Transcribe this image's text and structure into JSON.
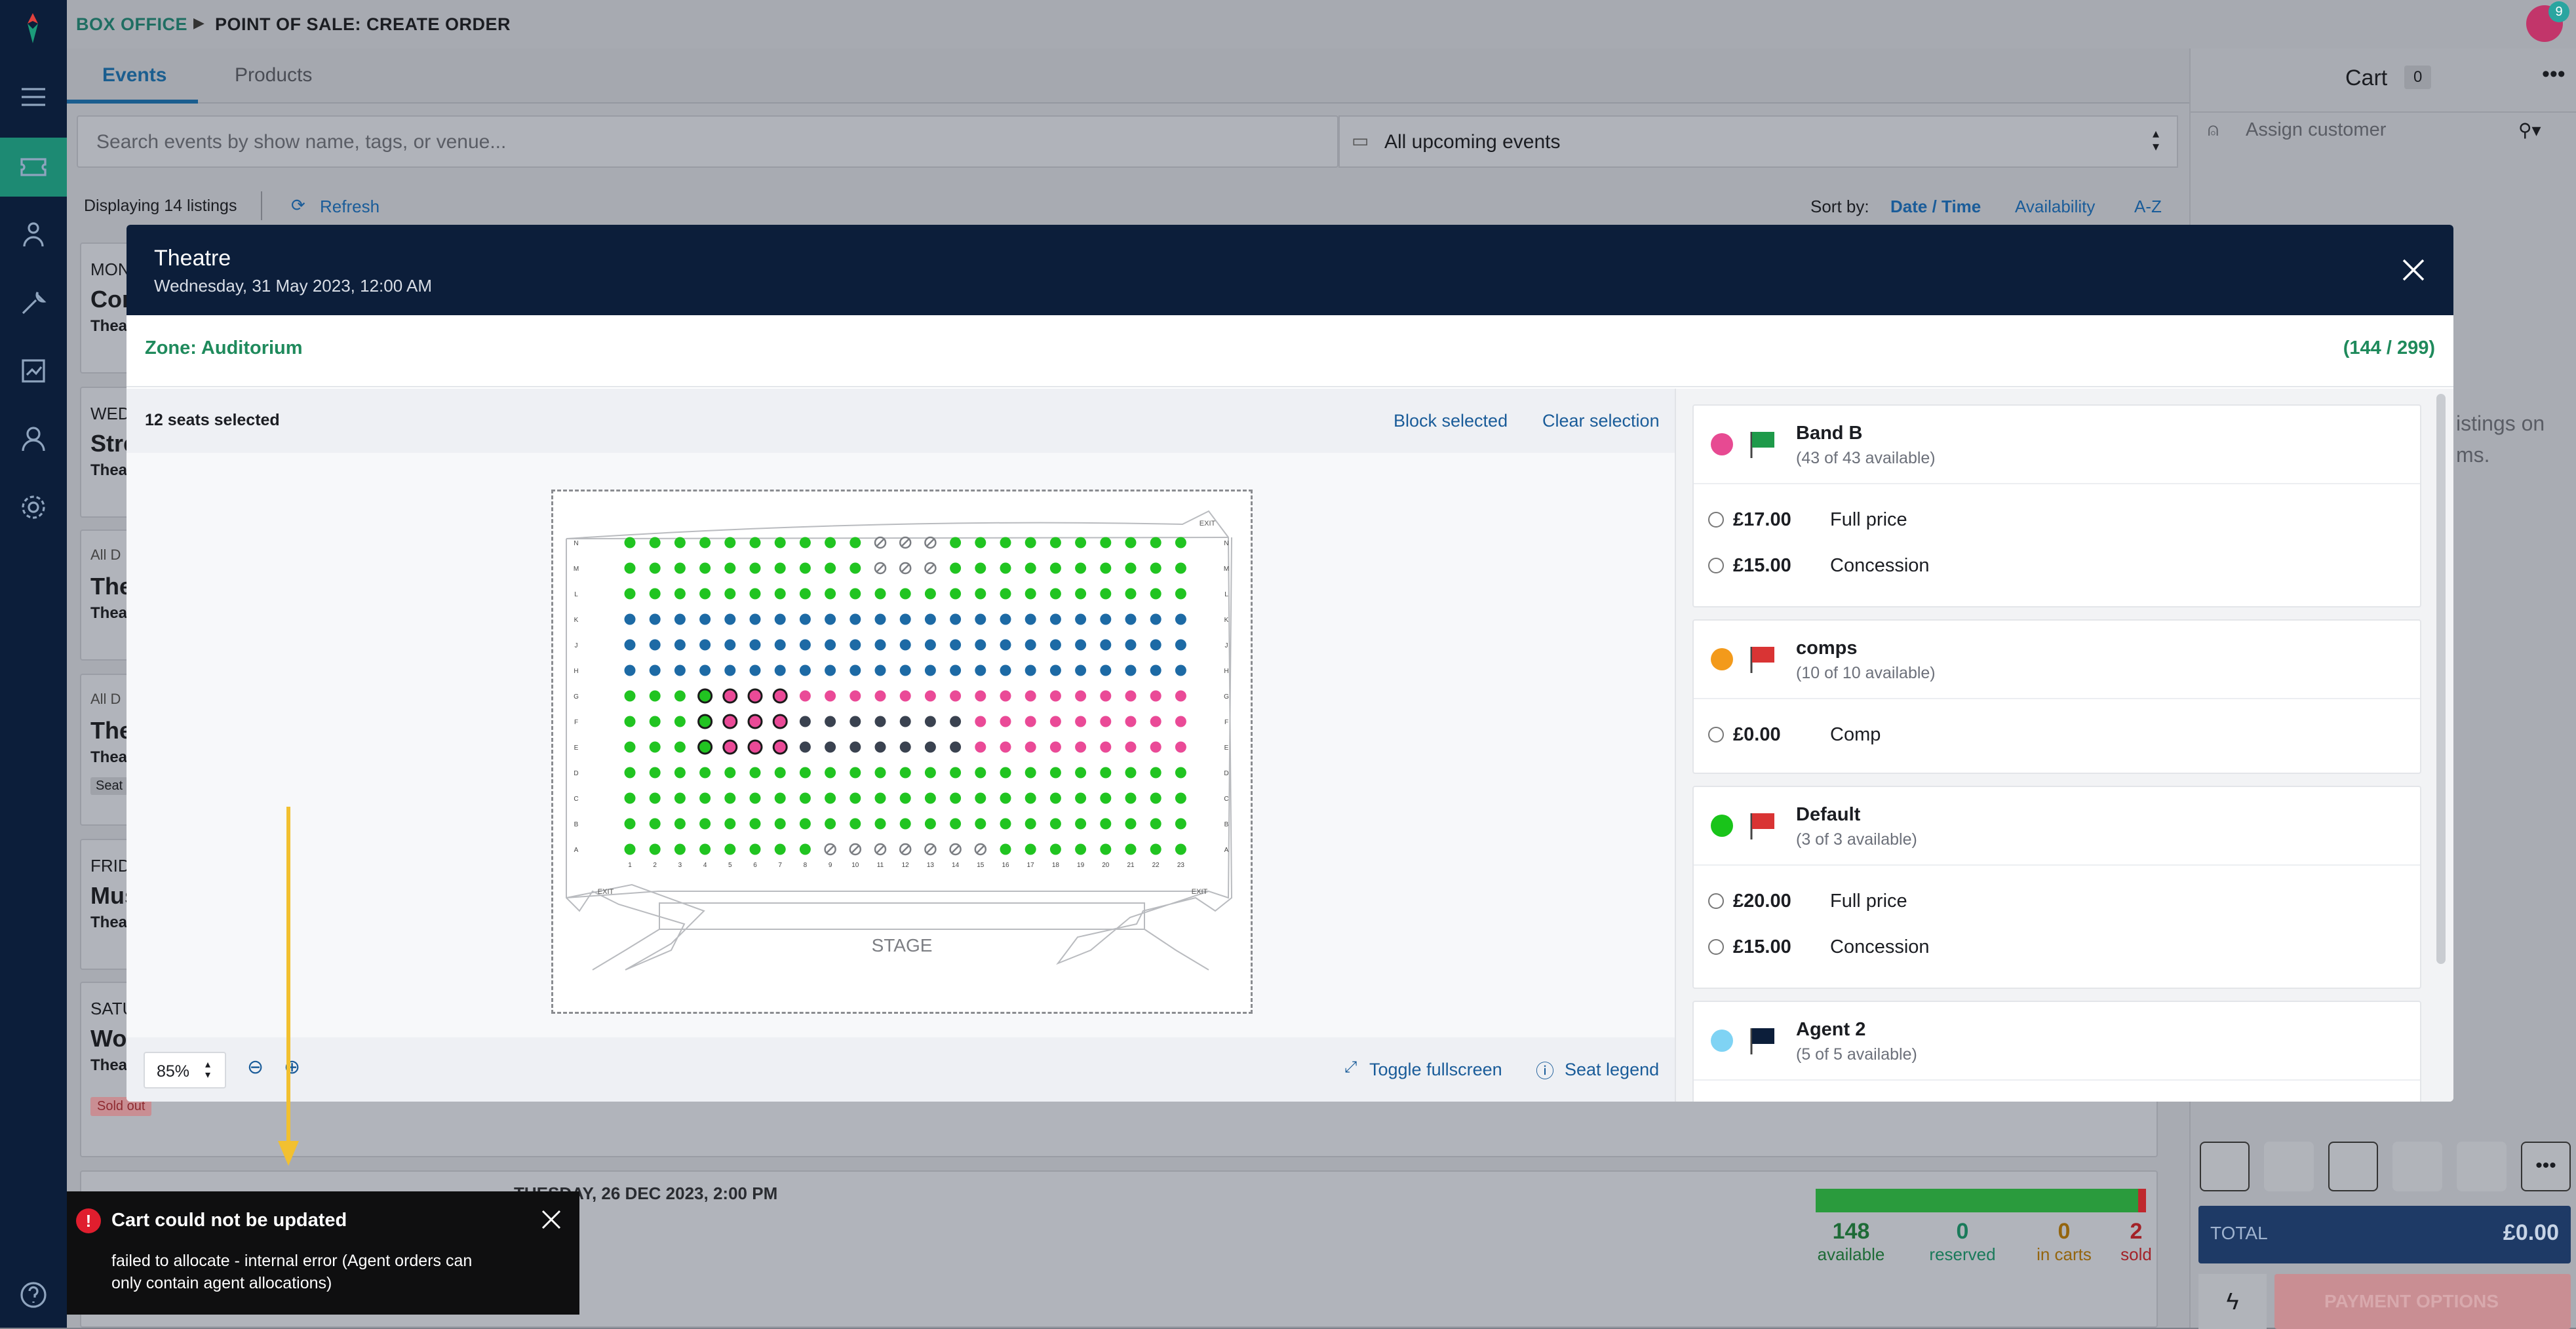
{
  "breadcrumb": {
    "section": "BOX OFFICE",
    "page": "POINT OF SALE: CREATE ORDER"
  },
  "notification_count": "9",
  "tabs": [
    {
      "label": "Events",
      "active": true
    },
    {
      "label": "Products",
      "active": false
    }
  ],
  "search": {
    "placeholder": "Search events by show name, tags, or venue..."
  },
  "date_filter": {
    "value": "All upcoming events"
  },
  "listing_bar": {
    "count": "Displaying 14 listings",
    "refresh": "Refresh",
    "sort_label": "Sort by:",
    "sort_options": [
      "Date / Time",
      "Availability",
      "A-Z"
    ],
    "active_sort": "Date / Time"
  },
  "listings": [
    {
      "day": "MON",
      "name": "Con",
      "venue": "Thea"
    },
    {
      "day": "WED",
      "name": "Stre",
      "venue": "Thea"
    },
    {
      "day": "All D",
      "name": "The",
      "venue": "Thea"
    },
    {
      "day": "All D",
      "name": "The",
      "venue": "Thea",
      "tag": "Seat"
    },
    {
      "day": "FRID",
      "name": "Mus",
      "venue": "Thea"
    },
    {
      "day": "SATU",
      "name": "Wor",
      "venue": "Thea",
      "badge": "Sold out"
    }
  ],
  "partial_listing_header": "TUESDAY, 26 DEC 2023, 2:00 PM",
  "stats": [
    {
      "value": "148",
      "label": "available",
      "color": "#1e7a3a"
    },
    {
      "value": "0",
      "label": "reserved",
      "color": "#1a9a6a"
    },
    {
      "value": "0",
      "label": "in carts",
      "color": "#b07a10"
    },
    {
      "value": "2",
      "label": "sold",
      "color": "#c0282d"
    }
  ],
  "cart": {
    "title": "Cart",
    "count": "0",
    "assign_customer": "Assign customer",
    "empty_text_1": "istings on",
    "empty_text_2": "ms.",
    "total_label": "TOTAL",
    "total_value": "£0.00",
    "payment": "PAYMENT OPTIONS"
  },
  "modal": {
    "title": "Theatre",
    "datetime": "Wednesday, 31 May 2023, 12:00 AM",
    "zone": "Zone: Auditorium",
    "capacity": "(144 / 299)",
    "selected": "12 seats selected",
    "block_selected": "Block selected",
    "clear_selection": "Clear selection",
    "zoom": "85%",
    "toggle_fullscreen": "Toggle fullscreen",
    "seat_legend": "Seat legend",
    "stage": "STAGE",
    "exit": "EXIT"
  },
  "seatmap": {
    "rows": [
      "N",
      "M",
      "L",
      "K",
      "J",
      "H",
      "G",
      "F",
      "E",
      "D",
      "C",
      "B",
      "A"
    ],
    "columns": [
      "1",
      "2",
      "3",
      "4",
      "5",
      "6",
      "7",
      "8",
      "9",
      "10",
      "11",
      "12",
      "13",
      "14",
      "15",
      "16",
      "17",
      "18",
      "19",
      "20",
      "21",
      "22",
      "23"
    ],
    "grid": [
      "ggggggggggXXXgggggggggg",
      "ggggggggggXXXgggggggggg",
      "ggggggggggggggggggggggg",
      "bbbbbbbbbbbbbbbbbbbbbbb",
      "bbbbbbbbbbbbbbbbbbbbbbb",
      "bbbbbbbbbbbbbbbbbbbbbbb",
      "gggGPPPppppppppppppppppp",
      "gggGPPPdddddddppppppppp",
      "gggGPPPdddddddppppppppp",
      "ggggggggggggggggggggggg",
      "ggggggggggggggggggggggg",
      "ggggggggggggggggggggggg",
      "ggggggggXXXXXXXgggggggg"
    ],
    "legend": {
      "g": "#21c421",
      "b": "#1d6aa5",
      "p": "#ea4a97",
      "d": "#3a4250",
      "X": "unavailable"
    }
  },
  "bands": [
    {
      "name": "Band B",
      "availability": "(43 of 43 available)",
      "color": "#e74a92",
      "flag": "#1e9a4a",
      "prices": [
        {
          "price": "£17.00",
          "type": "Full price"
        },
        {
          "price": "£15.00",
          "type": "Concession"
        }
      ]
    },
    {
      "name": "comps",
      "availability": "(10 of 10 available)",
      "color": "#f39a1b",
      "flag": "#d93434",
      "prices": [
        {
          "price": "£0.00",
          "type": "Comp"
        }
      ]
    },
    {
      "name": "Default",
      "availability": "(3 of 3 available)",
      "color": "#19c41a",
      "flag": "#d93434",
      "prices": [
        {
          "price": "£20.00",
          "type": "Full price"
        },
        {
          "price": "£15.00",
          "type": "Concession"
        }
      ]
    },
    {
      "name": "Agent 2",
      "availability": "(5 of 5 available)",
      "color": "#7fd3f4",
      "flag": "#0c1e3a",
      "prices": []
    }
  ],
  "toast": {
    "title": "Cart could not be updated",
    "message_1": "failed to allocate - internal error (Agent orders can",
    "message_2": "only contain agent allocations)"
  }
}
